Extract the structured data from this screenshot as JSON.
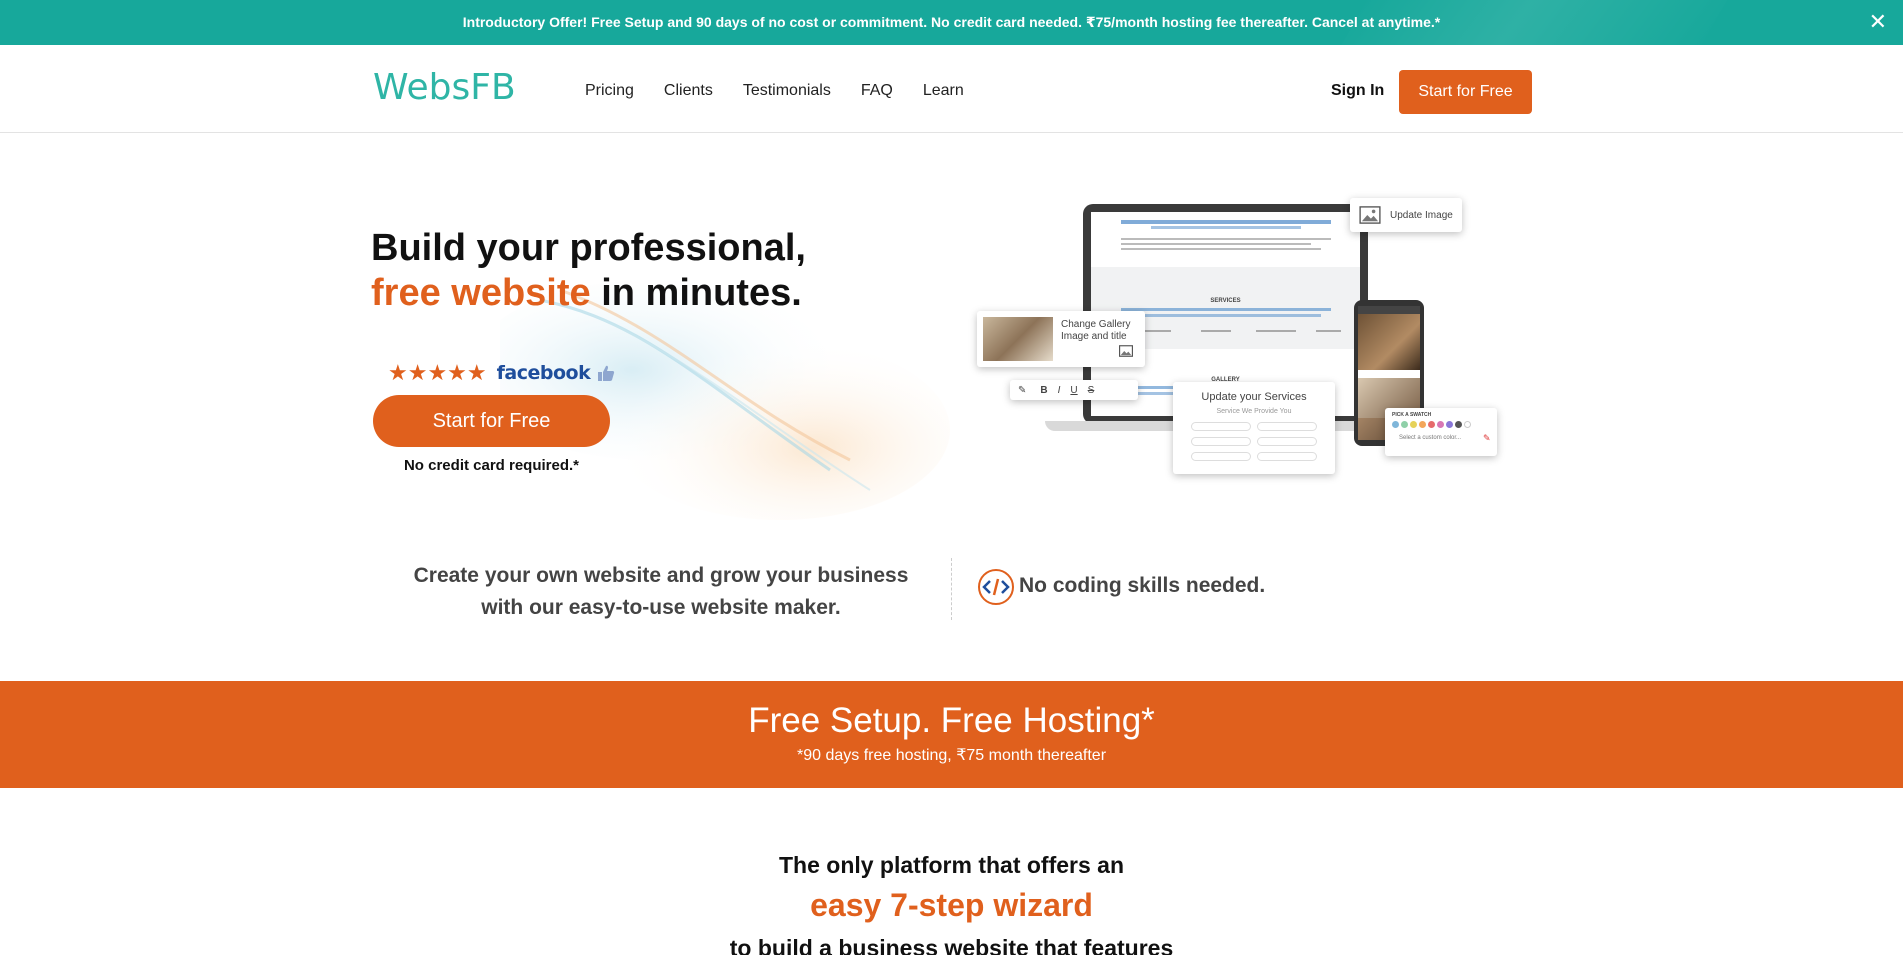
{
  "promo": {
    "text": "Introductory Offer! Free Setup and 90 days of no cost or commitment. No credit card needed. ₹75/month hosting fee thereafter. Cancel at anytime.*",
    "close_symbol": "✕"
  },
  "nav": {
    "logo": "WebsFB",
    "links": [
      "Pricing",
      "Clients",
      "Testimonials",
      "FAQ",
      "Learn"
    ],
    "signin": "Sign In",
    "cta": "Start for Free"
  },
  "hero": {
    "line1": "Build your professional,",
    "accent": "free website",
    "line2_rest": " in minutes.",
    "stars": "★★★★★",
    "rating_source": "facebook",
    "cta": "Start for Free",
    "note": "No credit card required.*"
  },
  "mockup": {
    "update_image": "Update Image",
    "change_gallery": "Change Gallery Image and title",
    "update_services": "Update your Services",
    "services_sub": "Service We Provide You",
    "pick_swatch": "PICK A SWATCH",
    "custom_color": "Select a custom color...",
    "section_services": "SERVICES",
    "section_gallery": "GALLERY",
    "editor_tools": [
      "B",
      "I",
      "U",
      "S"
    ],
    "swatch_colors": [
      "#7fb6d9",
      "#8fd0a8",
      "#e6d25a",
      "#f3a65a",
      "#e66b6b",
      "#d877b4",
      "#8a77d8",
      "#555555",
      "#ffffff"
    ]
  },
  "features": {
    "left_text": "Create your own website and grow your business with our easy-to-use website maker.",
    "right_text": "No coding skills needed."
  },
  "band": {
    "title": "Free Setup. Free Hosting*",
    "subtitle": "*90 days free hosting, ₹75 month thereafter"
  },
  "wizard": {
    "line1": "The only platform that offers an",
    "line2": "easy 7-step wizard",
    "line3": "to build a business website that features"
  },
  "colors": {
    "brand_teal": "#17a89b",
    "brand_orange": "#e0601d",
    "facebook_blue": "#1f4e9c"
  }
}
